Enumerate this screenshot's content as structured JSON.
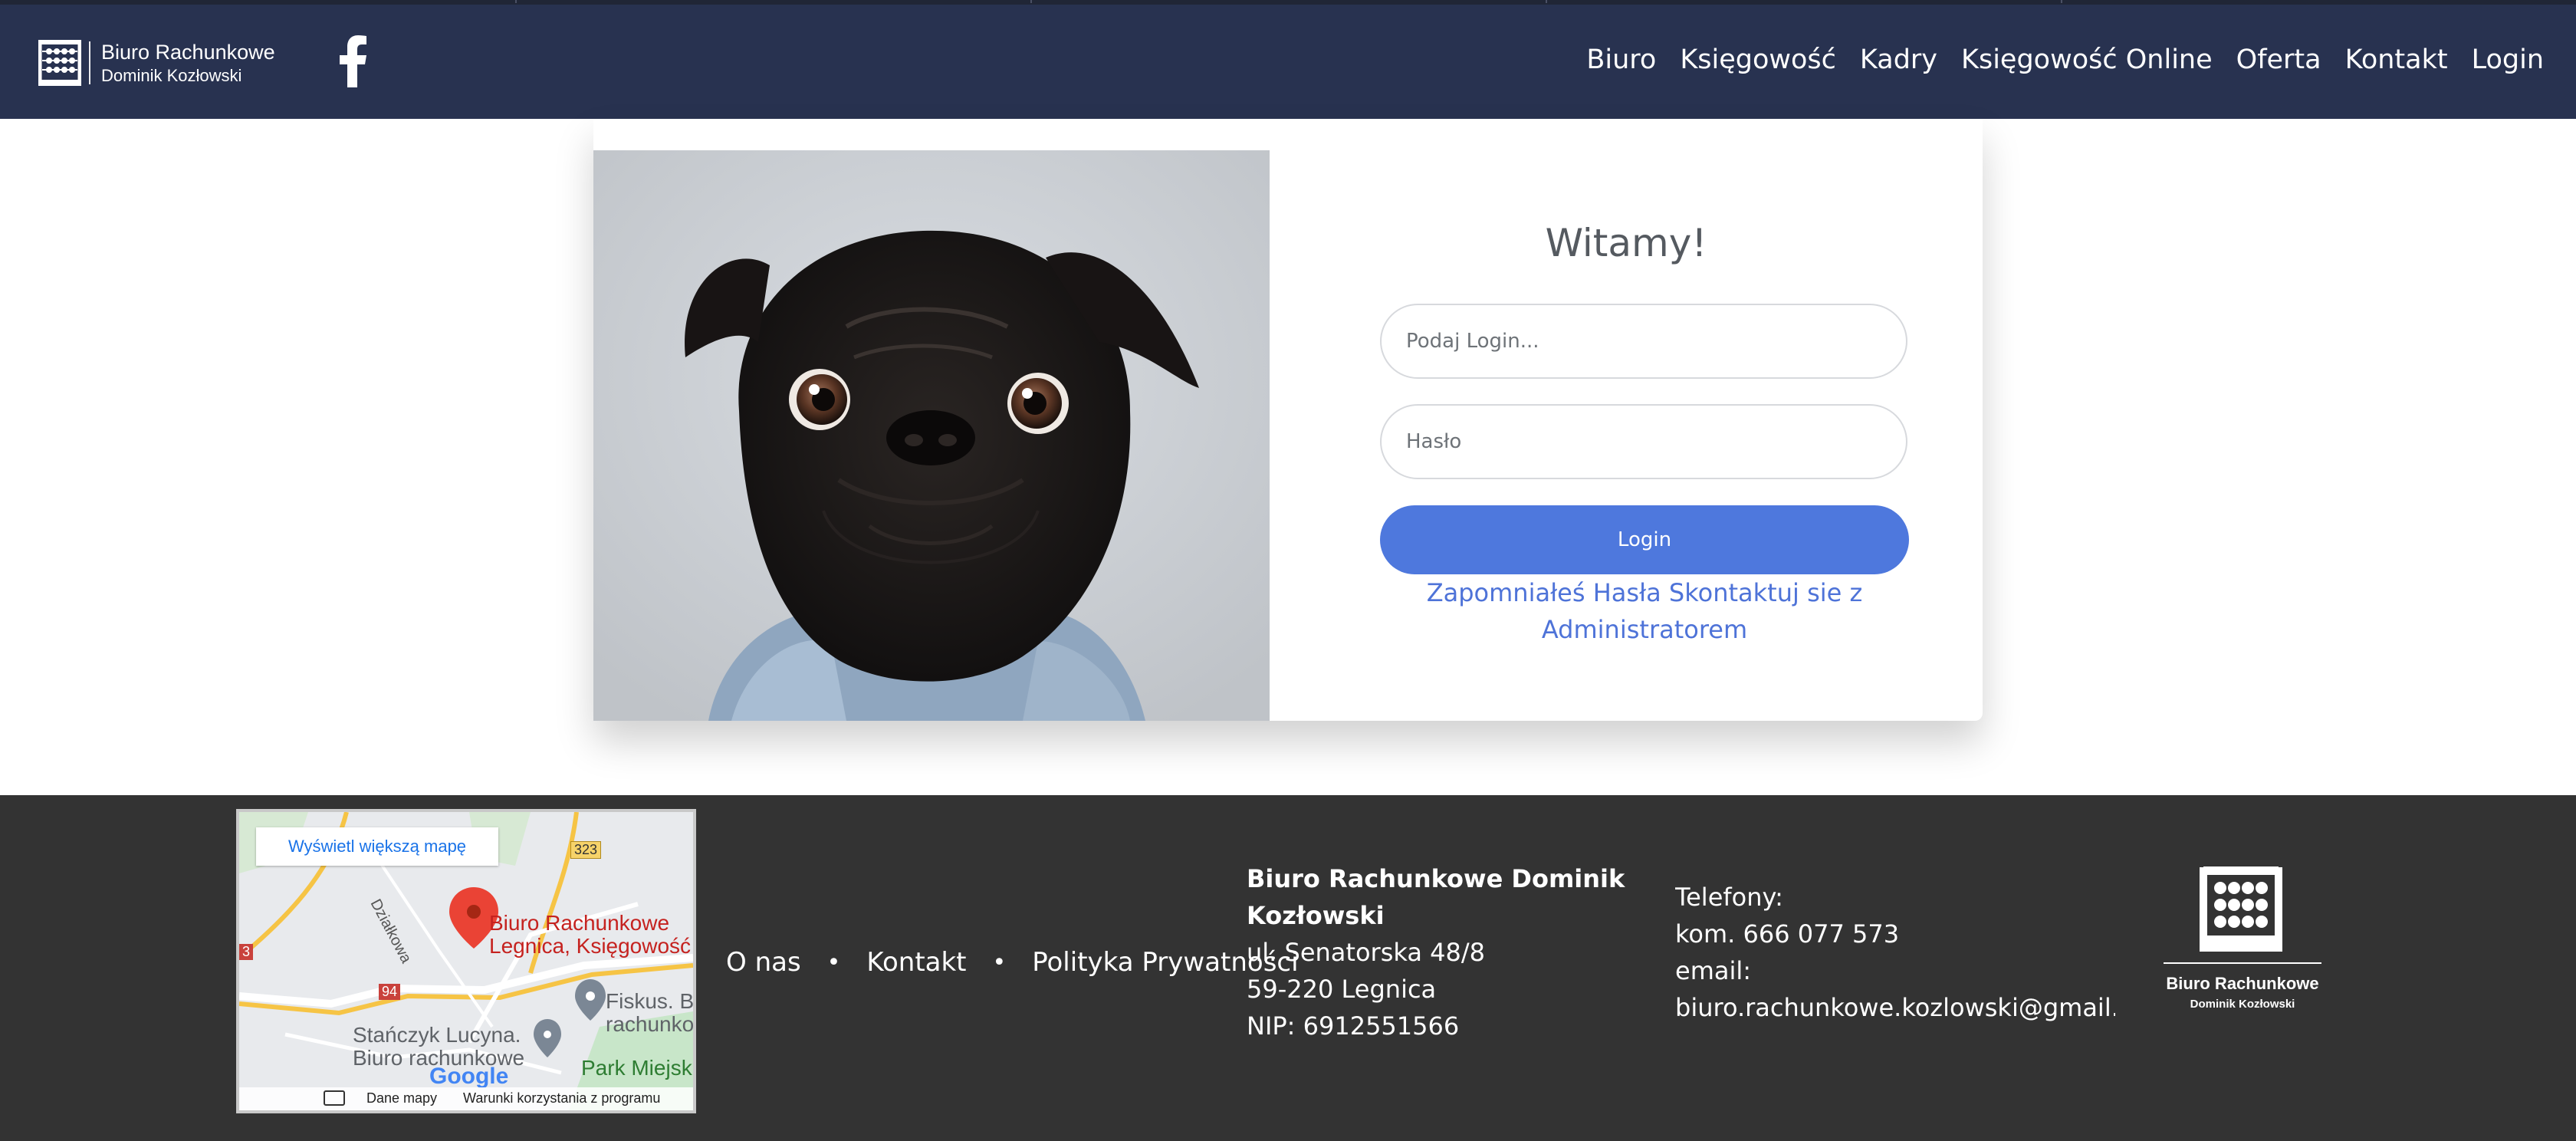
{
  "header": {
    "brand_line1": "Biuro Rachunkowe",
    "brand_line2": "Dominik Kozłowski",
    "brand_icon": "abacus-icon",
    "social_icon": "facebook-icon",
    "nav": [
      "Biuro",
      "Księgowość",
      "Kadry",
      "Księgowość Online",
      "Oferta",
      "Kontakt",
      "Login"
    ]
  },
  "login": {
    "welcome": "Witamy!",
    "login_placeholder": "Podaj Login...",
    "password_placeholder": "Hasło",
    "button_label": "Login",
    "forgot_line1": "Zapomniałeś Hasła Skontaktuj sie z",
    "forgot_line2": "Administratorem",
    "photo_icon": "pug-photo"
  },
  "footer": {
    "map": {
      "view_larger": "Wyświetl większą mapę",
      "pin_label_line1": "Biuro Rachunkowe",
      "pin_label_line2": "Legnica, Księgowość",
      "street": "Działkowa",
      "road_323": "323",
      "road_94": "94",
      "road_3": "3",
      "place1_line1": "Fiskus. B",
      "place1_line2": "rachunko",
      "place2_line1": "Stańczyk Lucyna.",
      "place2_line2": "Biuro rachunkowe",
      "place3": "Park Miejsk",
      "google": "Google",
      "map_data": "Dane mapy",
      "terms": "Warunki korzystania z programu"
    },
    "links": [
      "O nas",
      "Kontakt",
      "Polityka Prywatności"
    ],
    "separator": "•",
    "address": {
      "name_line1": "Biuro Rachunkowe Dominik",
      "name_line2": "Kozłowski",
      "street": "ul. Senatorska 48/8",
      "city": "59-220 Legnica",
      "nip": "NIP: 6912551566"
    },
    "contact": {
      "phones_label": "Telefony:",
      "phone": "kom. 666 077 573",
      "email_label": "email:",
      "email": "biuro.rachunkowe.kozlowski@gmail.com"
    },
    "logo": {
      "line1": "Biuro Rachunkowe",
      "line2": "Dominik Kozłowski"
    }
  },
  "colors": {
    "navbar": "#283250",
    "footer": "#333333",
    "button": "#4e78dd",
    "link": "#4e73d8"
  }
}
